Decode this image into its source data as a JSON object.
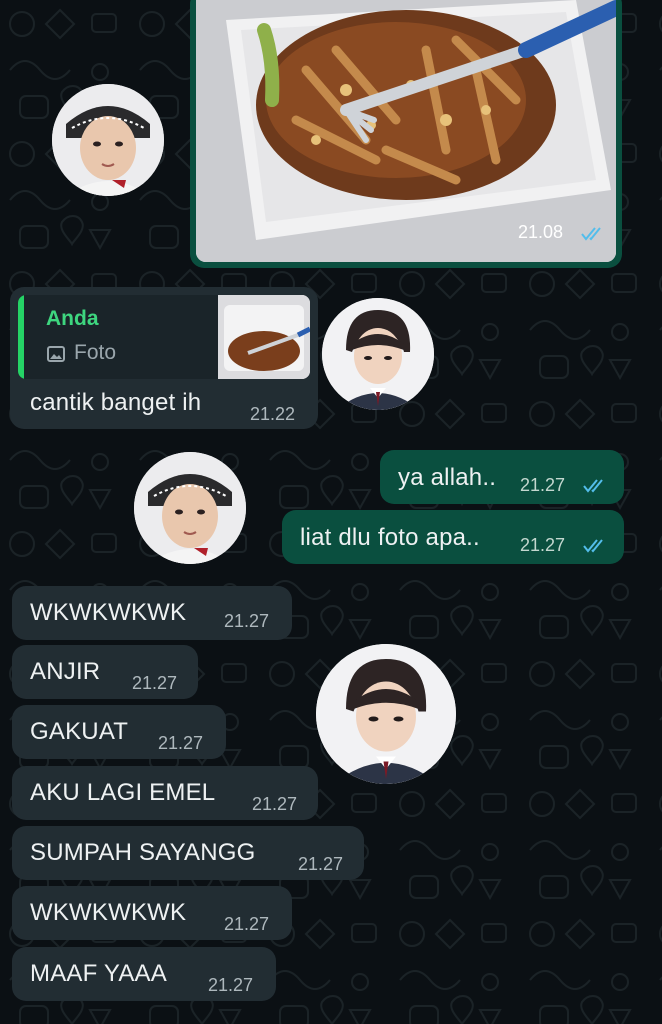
{
  "photo_message": {
    "time": "21.08",
    "status": "read"
  },
  "reply_message": {
    "quoted_author": "Anda",
    "quoted_type": "Foto",
    "text": "cantik banget ih",
    "time": "21.22"
  },
  "outgoing": [
    {
      "text": "ya allah..",
      "time": "21.27"
    },
    {
      "text": "liat dlu foto apa..",
      "time": "21.27"
    }
  ],
  "incoming": [
    {
      "text": "WKWKWKWK",
      "time": "21.27"
    },
    {
      "text": "ANJIR",
      "time": "21.27"
    },
    {
      "text": "GAKUAT",
      "time": "21.27"
    },
    {
      "text": "AKU LAGI EMEL",
      "time": "21.27"
    },
    {
      "text": "SUMPAH SAYANGG",
      "time": "21.27"
    },
    {
      "text": "WKWKWKWK",
      "time": "21.27"
    },
    {
      "text": "MAAF YAAA",
      "time": "21.27"
    }
  ],
  "colors": {
    "background": "#0b1014",
    "incoming_bubble": "#222d33",
    "outgoing_bubble": "#0a4f3f",
    "read_ticks": "#53bdeb",
    "accent_green": "#25d366"
  }
}
